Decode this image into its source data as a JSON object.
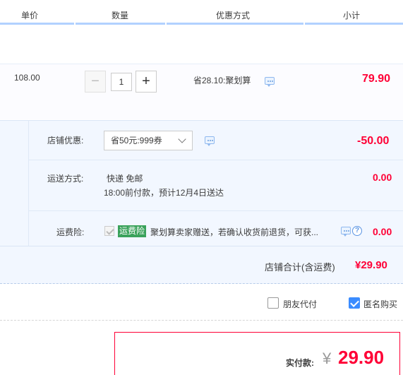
{
  "header": {
    "col_price": "单价",
    "col_qty": "数量",
    "col_discount": "优惠方式",
    "col_subtotal": "小计"
  },
  "item": {
    "unit_price": "108.00",
    "minus": "−",
    "quantity": "1",
    "plus": "+",
    "discount_text": "省28.10:聚划算",
    "subtotal": "79.90"
  },
  "shop": {
    "coupon_label": "店铺优惠:",
    "coupon_selected": "省50元:999券",
    "coupon_amount": "-50.00",
    "shipping_label": "运送方式:",
    "shipping_method": "快递 免邮",
    "shipping_note": "18:00前付款，预计12月4日送达",
    "shipping_amount": "0.00",
    "insurance_label": "运费险:",
    "insurance_badge": "运费险",
    "insurance_text": "聚划算卖家赠送，若确认收货前退货，可获...",
    "insurance_amount": "0.00",
    "help": "?"
  },
  "total": {
    "label": "店铺合计(含运费)",
    "amount": "¥29.90"
  },
  "options": {
    "friend_pay": "朋友代付",
    "friend_pay_checked": false,
    "anonymous": "匿名购买",
    "anonymous_checked": true
  },
  "payment": {
    "label": "实付款:",
    "currency": "¥",
    "amount": "29.90"
  },
  "colors": {
    "accent_red": "#ff0036",
    "header_line": "#b2d1ff",
    "checkbox_blue": "#3b8cff",
    "badge_green": "#3aa25b"
  }
}
